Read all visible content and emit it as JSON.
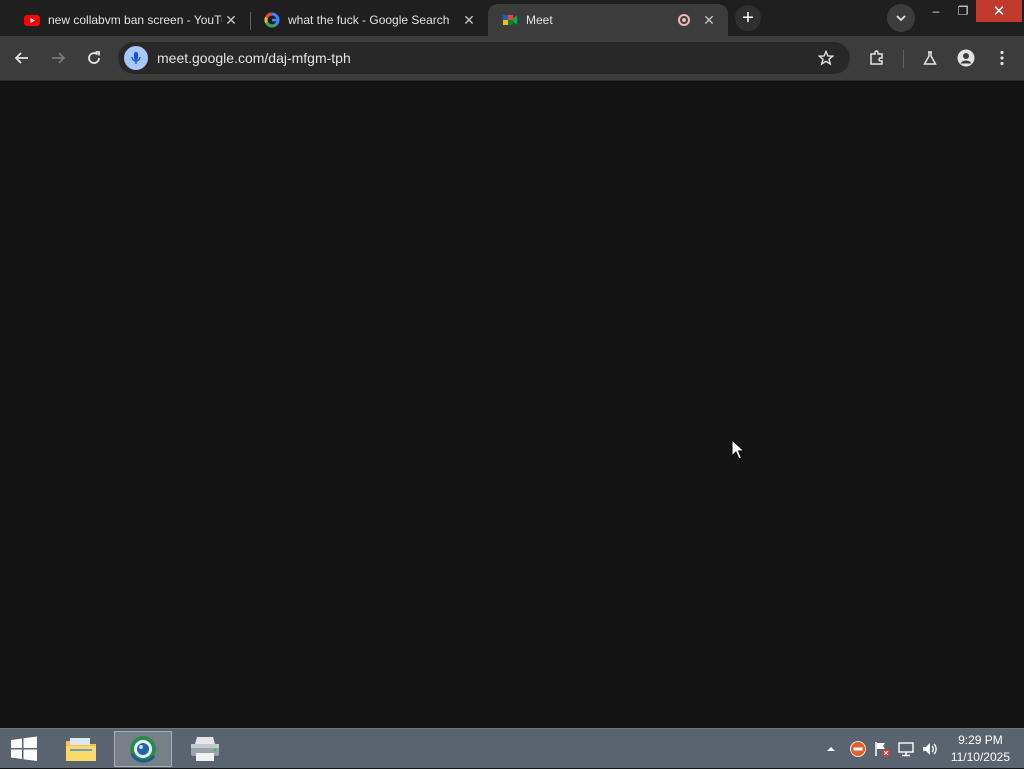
{
  "browser": {
    "tabs": [
      {
        "title": "new collabvm ban screen - YouTube",
        "favicon": "youtube-icon",
        "active": false
      },
      {
        "title": "what the fuck - Google Search",
        "favicon": "google-icon",
        "active": false
      },
      {
        "title": "Meet",
        "favicon": "google-meet-icon",
        "active": true,
        "recording": true
      }
    ],
    "omnibox": {
      "url": "meet.google.com/daj-mfgm-tph"
    },
    "window_controls": {
      "minimize": "–",
      "restore": "❐",
      "close": "✕"
    }
  },
  "taskbar": {
    "apps": [
      {
        "name": "file-explorer",
        "icon": "folder-icon"
      },
      {
        "name": "browser",
        "icon": "browser-icon",
        "active": true
      },
      {
        "name": "printer",
        "icon": "printer-icon"
      }
    ],
    "clock": {
      "time": "9:29 PM",
      "date": "11/10/2025"
    }
  },
  "colors": {
    "tabbar": "#1f1f1f",
    "toolbar": "#3c3c3c",
    "content": "#131314",
    "taskbar": "#5a6470",
    "close": "#c0392b"
  }
}
